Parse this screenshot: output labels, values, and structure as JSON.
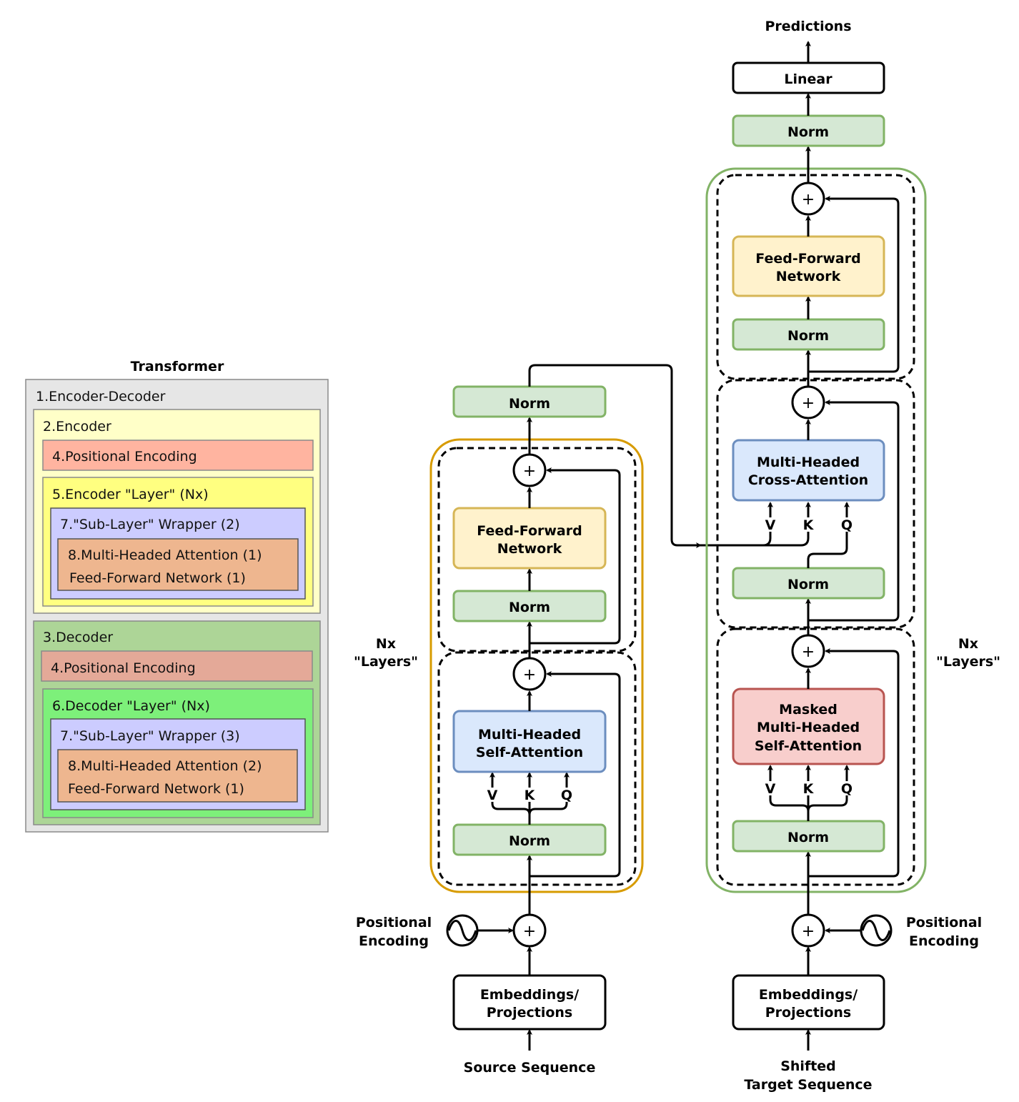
{
  "legend": {
    "title": "Transformer",
    "encoder_decoder": "1.Encoder-Decoder",
    "encoder": "2.Encoder",
    "enc_pos": "4.Positional Encoding",
    "enc_layer": "5.Encoder \"Layer\" (Nx)",
    "enc_sublayer": "7.\"Sub-Layer\" Wrapper (2)",
    "enc_mha": "8.Multi-Headed Attention (1)",
    "enc_ffn": "Feed-Forward Network (1)",
    "decoder": "3.Decoder",
    "dec_pos": "4.Positional Encoding",
    "dec_layer": "6.Decoder \"Layer\" (Nx)",
    "dec_sublayer": "7.\"Sub-Layer\" Wrapper (3)",
    "dec_mha": "8.Multi-Headed Attention (2)",
    "dec_ffn": "Feed-Forward Network (1)",
    "colors": {
      "outer": "#e6e6e6",
      "encoder": "#ffffc8",
      "enc_pos": "#ffb4a0",
      "enc_layer": "#ffff80",
      "sublayer": "#ccccff",
      "mha": "#eeb68f",
      "decoder": "#add597",
      "dec_pos": "#e4a998",
      "dec_layer": "#7df07a"
    }
  },
  "encoder": {
    "input": "Source Sequence",
    "embed": [
      "Embeddings/",
      "Projections"
    ],
    "pos": [
      "Positional",
      "Encoding"
    ],
    "nx": [
      "Nx",
      "\"Layers\""
    ],
    "norm": "Norm",
    "attn": [
      "Multi-Headed",
      "Self-Attention"
    ],
    "ffn": [
      "Feed-Forward",
      "Network"
    ],
    "v": "V",
    "k": "K",
    "q": "Q",
    "plus": "+",
    "border_color": "#d79b00"
  },
  "decoder": {
    "input": [
      "Shifted",
      "Target Sequence"
    ],
    "embed": [
      "Embeddings/",
      "Projections"
    ],
    "pos": [
      "Positional",
      "Encoding"
    ],
    "nx": [
      "Nx",
      "\"Layers\""
    ],
    "norm": "Norm",
    "masked": [
      "Masked",
      "Multi-Headed",
      "Self-Attention"
    ],
    "cross": [
      "Multi-Headed",
      "Cross-Attention"
    ],
    "ffn": [
      "Feed-Forward",
      "Network"
    ],
    "linear": "Linear",
    "output": "Predictions",
    "v": "V",
    "k": "K",
    "q": "Q",
    "plus": "+",
    "border_color": "#82b366"
  }
}
